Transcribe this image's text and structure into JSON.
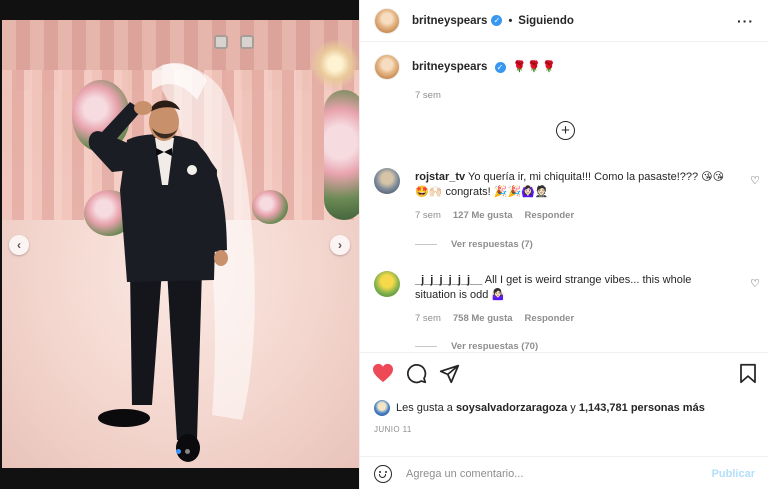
{
  "post": {
    "author": "britneyspears",
    "separator": "•",
    "follow_status": "Siguiendo",
    "more_icon": "···",
    "caption_emojis": "🌹🌹🌹",
    "caption_time": "7 sem",
    "carousel_prev": "‹",
    "carousel_next": "›",
    "carousel_total": 2,
    "carousel_active": 1
  },
  "load_more_glyph": "+",
  "comments": [
    {
      "user": "rojstar_tv",
      "text": "Yo quería ir, mi chiquita!!! Como la pasaste!??? 😘😘🤩🙌🏻 congrats! 🎉🎉🙆🏻‍♀️🤵🏻",
      "time": "7 sem",
      "likes": "127 Me gusta",
      "reply": "Responder",
      "replies": "Ver respuestas (7)"
    },
    {
      "user": "_j_j_j_j_j_j__",
      "text": "All I get is weird strange vibes... this whole situation is odd 🤷🏻‍♀️",
      "time": "7 sem",
      "likes": "758 Me gusta",
      "reply": "Responder",
      "replies": "Ver respuestas (70)"
    }
  ],
  "likes_line": {
    "prefix": "Les gusta a",
    "user": "soysalvadorzaragoza",
    "middle": "y",
    "count": "1,143,781 personas más"
  },
  "date": "JUNIO 11",
  "comment_box": {
    "placeholder": "Agrega un comentario...",
    "publish": "Publicar"
  },
  "colors": {
    "heart_liked": "#ed4956",
    "verified": "#3897f0",
    "publish_disabled": "#b2dffc",
    "carousel_active_dot": "#3d94ff"
  }
}
